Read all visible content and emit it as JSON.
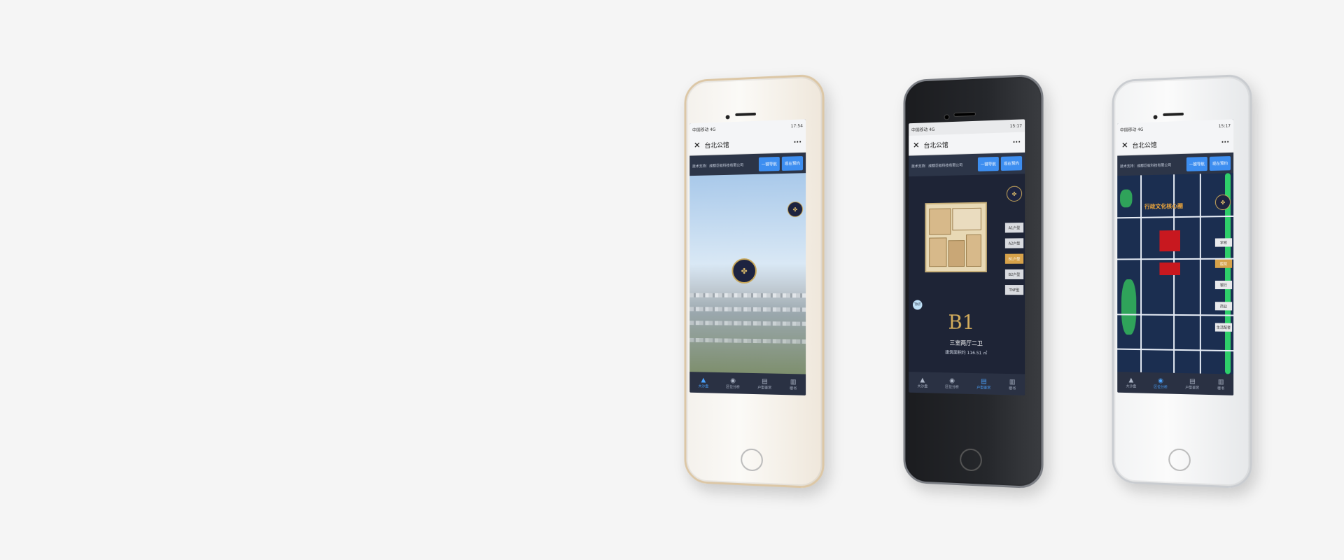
{
  "phones": [
    {
      "status_time": "17:54",
      "carrier": "中国移动 4G",
      "title": "台北公馆",
      "support": "技术支持：成都巨蚁科技有限公司",
      "buttons": [
        "一键导航",
        "现在预约"
      ],
      "tabs": [
        {
          "label": "大沙盘",
          "icon": "▲"
        },
        {
          "label": "区位分析",
          "icon": "◉"
        },
        {
          "label": "户型鉴赏",
          "icon": "▤"
        },
        {
          "label": "楼书",
          "icon": "▥"
        }
      ],
      "active_tab": 0
    },
    {
      "status_time": "15:17",
      "carrier": "中国移动 4G",
      "title": "台北公馆",
      "support": "技术支持：成都巨蚁科技有限公司",
      "buttons": [
        "一键导航",
        "现在预约"
      ],
      "units": [
        "A1户型",
        "A2户型",
        "B1户型",
        "B2户型",
        "TNF型"
      ],
      "active_unit": 2,
      "plan_label": "B1",
      "layout_name": "三室两厅二卫",
      "area": "建筑面积约 116.51 ㎡",
      "circle_label": "TNT",
      "tabs": [
        {
          "label": "大沙盘",
          "icon": "▲"
        },
        {
          "label": "区位分析",
          "icon": "◉"
        },
        {
          "label": "户型鉴赏",
          "icon": "▤"
        },
        {
          "label": "楼书",
          "icon": "▥"
        }
      ],
      "active_tab": 2
    },
    {
      "status_time": "15:17",
      "carrier": "中国移动 4G",
      "title": "台北公馆",
      "support": "技术支持：成都巨蚁科技有限公司",
      "buttons": [
        "一键导航",
        "现在预约"
      ],
      "district": "行政文化核心圈",
      "side_tags": [
        "学校",
        "医院",
        "银行",
        "商业",
        "生活配套"
      ],
      "tabs": [
        {
          "label": "大沙盘",
          "icon": "▲"
        },
        {
          "label": "区位分析",
          "icon": "◉"
        },
        {
          "label": "户型鉴赏",
          "icon": "▤"
        },
        {
          "label": "楼书",
          "icon": "▥"
        }
      ],
      "active_tab": 1
    }
  ],
  "colors": {
    "accent": "#3d8ef0",
    "navy": "#1e2436",
    "gold": "#d4ad5c"
  }
}
